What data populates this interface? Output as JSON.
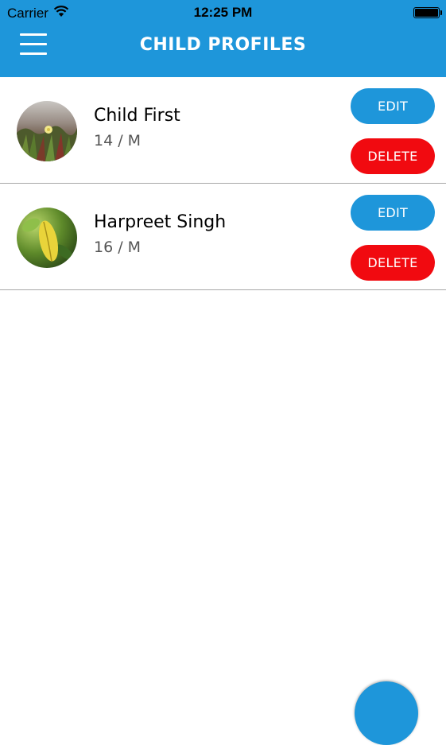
{
  "status_bar": {
    "carrier": "Carrier",
    "time": "12:25 PM",
    "wifi_icon": "wifi-icon",
    "battery_icon": "battery-icon"
  },
  "header": {
    "title": "CHILD PROFILES",
    "menu_icon": "hamburger-menu-icon",
    "background_color": "#1e96da"
  },
  "profiles": [
    {
      "name": "Child First",
      "meta": "14 / M",
      "avatar": "flower-photo",
      "edit_label": "EDIT",
      "delete_label": "DELETE"
    },
    {
      "name": "Harpreet Singh",
      "meta": "16 / M",
      "avatar": "leaf-photo",
      "edit_label": "EDIT",
      "delete_label": "DELETE"
    }
  ],
  "colors": {
    "accent": "#1e96da",
    "delete": "#f10a10"
  }
}
